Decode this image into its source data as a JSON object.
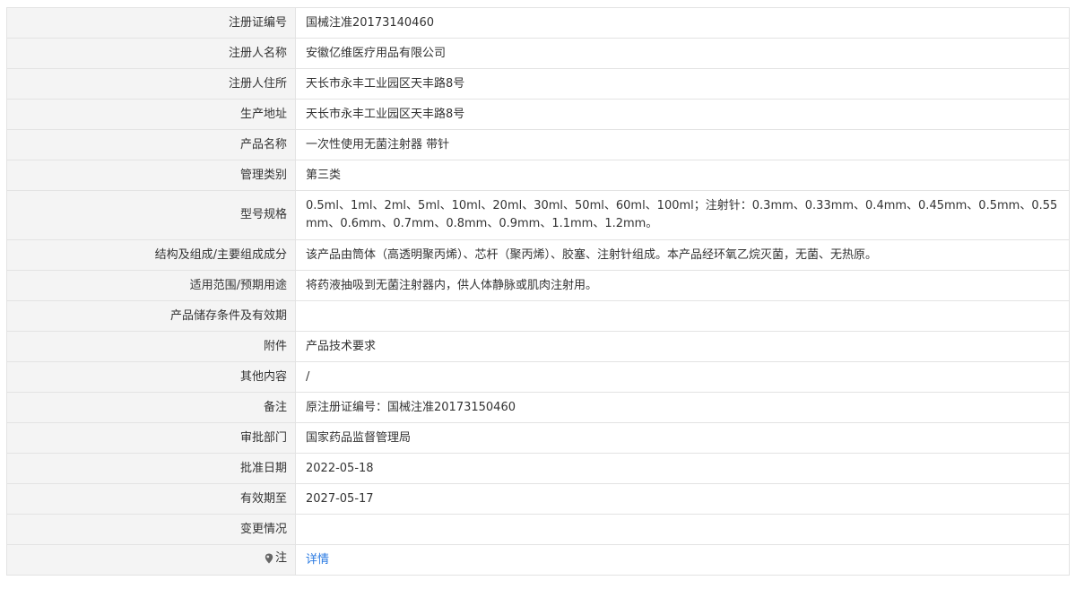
{
  "rows": [
    {
      "label": "注册证编号",
      "value": "国械注准20173140460"
    },
    {
      "label": "注册人名称",
      "value": "安徽亿维医疗用品有限公司"
    },
    {
      "label": "注册人住所",
      "value": "天长市永丰工业园区天丰路8号"
    },
    {
      "label": "生产地址",
      "value": "天长市永丰工业园区天丰路8号"
    },
    {
      "label": "产品名称",
      "value": "一次性使用无菌注射器 带针"
    },
    {
      "label": "管理类别",
      "value": "第三类"
    },
    {
      "label": "型号规格",
      "value": "0.5ml、1ml、2ml、5ml、10ml、20ml、30ml、50ml、60ml、100ml；注射针：0.3mm、0.33mm、0.4mm、0.45mm、0.5mm、0.55mm、0.6mm、0.7mm、0.8mm、0.9mm、1.1mm、1.2mm。"
    },
    {
      "label": "结构及组成/主要组成成分",
      "value": "该产品由筒体（高透明聚丙烯）、芯杆（聚丙烯）、胶塞、注射针组成。本产品经环氧乙烷灭菌，无菌、无热原。"
    },
    {
      "label": "适用范围/预期用途",
      "value": "将药液抽吸到无菌注射器内，供人体静脉或肌肉注射用。"
    },
    {
      "label": "产品储存条件及有效期",
      "value": ""
    },
    {
      "label": "附件",
      "value": "产品技术要求"
    },
    {
      "label": "其他内容",
      "value": "/"
    },
    {
      "label": "备注",
      "value": "原注册证编号：国械注准20173150460"
    },
    {
      "label": "审批部门",
      "value": "国家药品监督管理局"
    },
    {
      "label": "批准日期",
      "value": "2022-05-18"
    },
    {
      "label": "有效期至",
      "value": "2027-05-17"
    },
    {
      "label": "变更情况",
      "value": ""
    }
  ],
  "note_row": {
    "icon": "pin-icon",
    "label": "注",
    "link_text": "详情",
    "link_color": "#2a7ae2"
  }
}
